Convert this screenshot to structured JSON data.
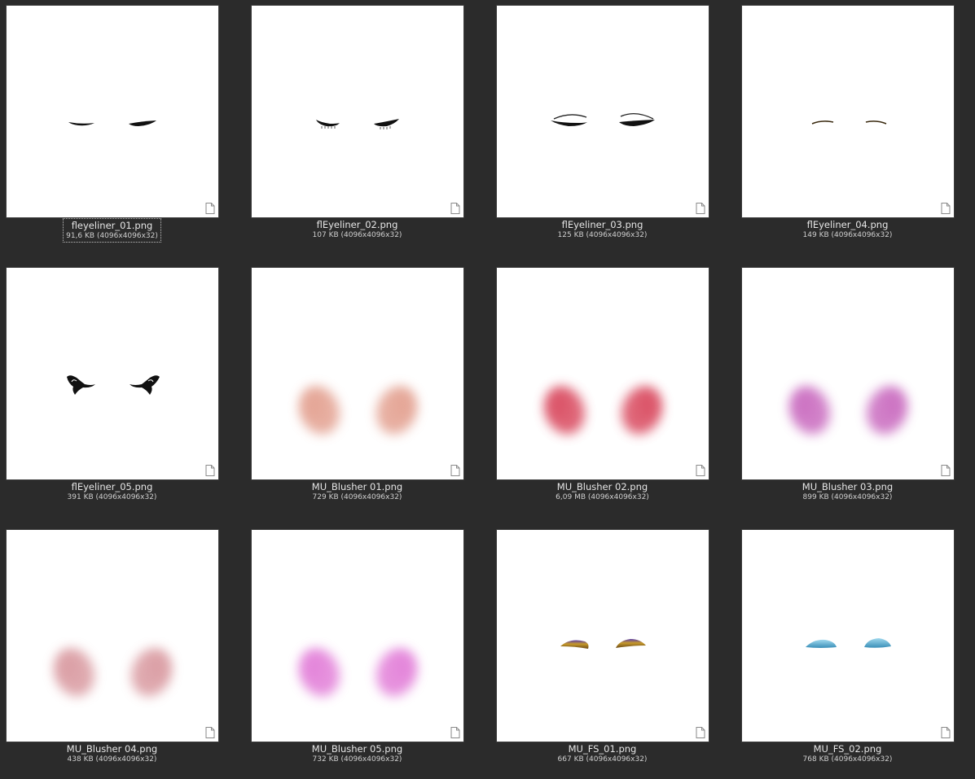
{
  "files": [
    {
      "name": "fleyeliner_01.png",
      "meta": "91,6 KB (4096x4096x32)",
      "art": "eyeliner-thin",
      "selected": true
    },
    {
      "name": "flEyeliner_02.png",
      "meta": "107 KB (4096x4096x32)",
      "art": "eyeliner-lashes",
      "selected": false
    },
    {
      "name": "flEyeliner_03.png",
      "meta": "125 KB (4096x4096x32)",
      "art": "eyeliner-double",
      "selected": false
    },
    {
      "name": "flEyeliner_04.png",
      "meta": "149 KB (4096x4096x32)",
      "art": "eyeliner-brown",
      "selected": false
    },
    {
      "name": "flEyeliner_05.png",
      "meta": "391 KB (4096x4096x32)",
      "art": "eyeliner-wing",
      "selected": false
    },
    {
      "name": "MU_Blusher 01.png",
      "meta": "729 KB (4096x4096x32)",
      "art": "blusher",
      "color": "#e3a090",
      "selected": false
    },
    {
      "name": "MU_Blusher 02.png",
      "meta": "6,09 MB (4096x4096x32)",
      "art": "blusher",
      "color": "#d9485e",
      "selected": false
    },
    {
      "name": "MU_Blusher 03.png",
      "meta": "899 KB (4096x4096x32)",
      "art": "blusher",
      "color": "#c96bbf",
      "selected": false
    },
    {
      "name": "MU_Blusher 04.png",
      "meta": "438 KB (4096x4096x32)",
      "art": "blusher",
      "color": "#d99aa0",
      "selected": false
    },
    {
      "name": "MU_Blusher 05.png",
      "meta": "732 KB (4096x4096x32)",
      "art": "blusher",
      "color": "#e27ed8",
      "selected": false
    },
    {
      "name": "MU_FS_01.png",
      "meta": "667 KB (4096x4096x32)",
      "art": "shadow-gold",
      "selected": false
    },
    {
      "name": "MU_FS_02.png",
      "meta": "768 KB (4096x4096x32)",
      "art": "shadow-blue",
      "selected": false
    }
  ],
  "icons": {
    "file": "document-icon"
  },
  "colors": {
    "background": "#2b2b2b",
    "caption": "#e6e6e6"
  }
}
